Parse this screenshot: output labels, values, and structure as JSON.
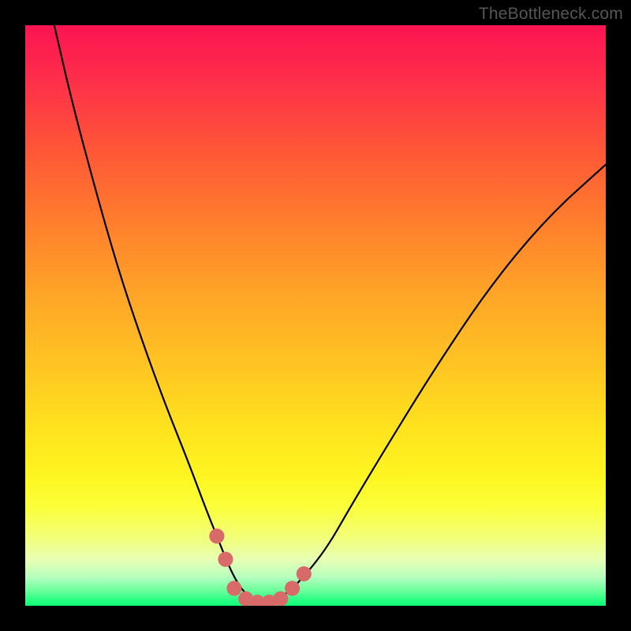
{
  "watermark": "TheBottleneck.com",
  "chart_data": {
    "type": "line",
    "title": "",
    "xlabel": "",
    "ylabel": "",
    "xlim": [
      0,
      100
    ],
    "ylim": [
      0,
      100
    ],
    "series": [
      {
        "name": "curve",
        "color": "#000000",
        "x": [
          5,
          8,
          12,
          16,
          20,
          24,
          28,
          31,
          33,
          35,
          36.5,
          38,
          40,
          42,
          45,
          48,
          52,
          56,
          62,
          70,
          80,
          90,
          100
        ],
        "y": [
          100,
          87,
          72,
          58,
          46,
          35,
          25,
          17,
          12,
          7,
          4,
          2,
          0.5,
          0.5,
          2,
          5,
          10,
          17,
          27,
          40,
          55,
          67,
          76
        ]
      }
    ],
    "markers": {
      "name": "highlight-dots",
      "color": "#d86a6a",
      "radius_pct": 1.3,
      "points": [
        {
          "x": 33.0,
          "y": 12.0
        },
        {
          "x": 34.5,
          "y": 8.0
        },
        {
          "x": 36.0,
          "y": 3.0
        },
        {
          "x": 38.0,
          "y": 1.2
        },
        {
          "x": 40.0,
          "y": 0.6
        },
        {
          "x": 42.0,
          "y": 0.6
        },
        {
          "x": 44.0,
          "y": 1.2
        },
        {
          "x": 46.0,
          "y": 3.0
        },
        {
          "x": 48.0,
          "y": 5.5
        }
      ]
    },
    "gradient_stops": [
      {
        "pct": 0,
        "color": "#fb1452"
      },
      {
        "pct": 22,
        "color": "#ff5837"
      },
      {
        "pct": 46,
        "color": "#ffa428"
      },
      {
        "pct": 70,
        "color": "#ffe41e"
      },
      {
        "pct": 88,
        "color": "#f2ff76"
      },
      {
        "pct": 97,
        "color": "#67ff9a"
      },
      {
        "pct": 100,
        "color": "#0eff77"
      }
    ]
  }
}
